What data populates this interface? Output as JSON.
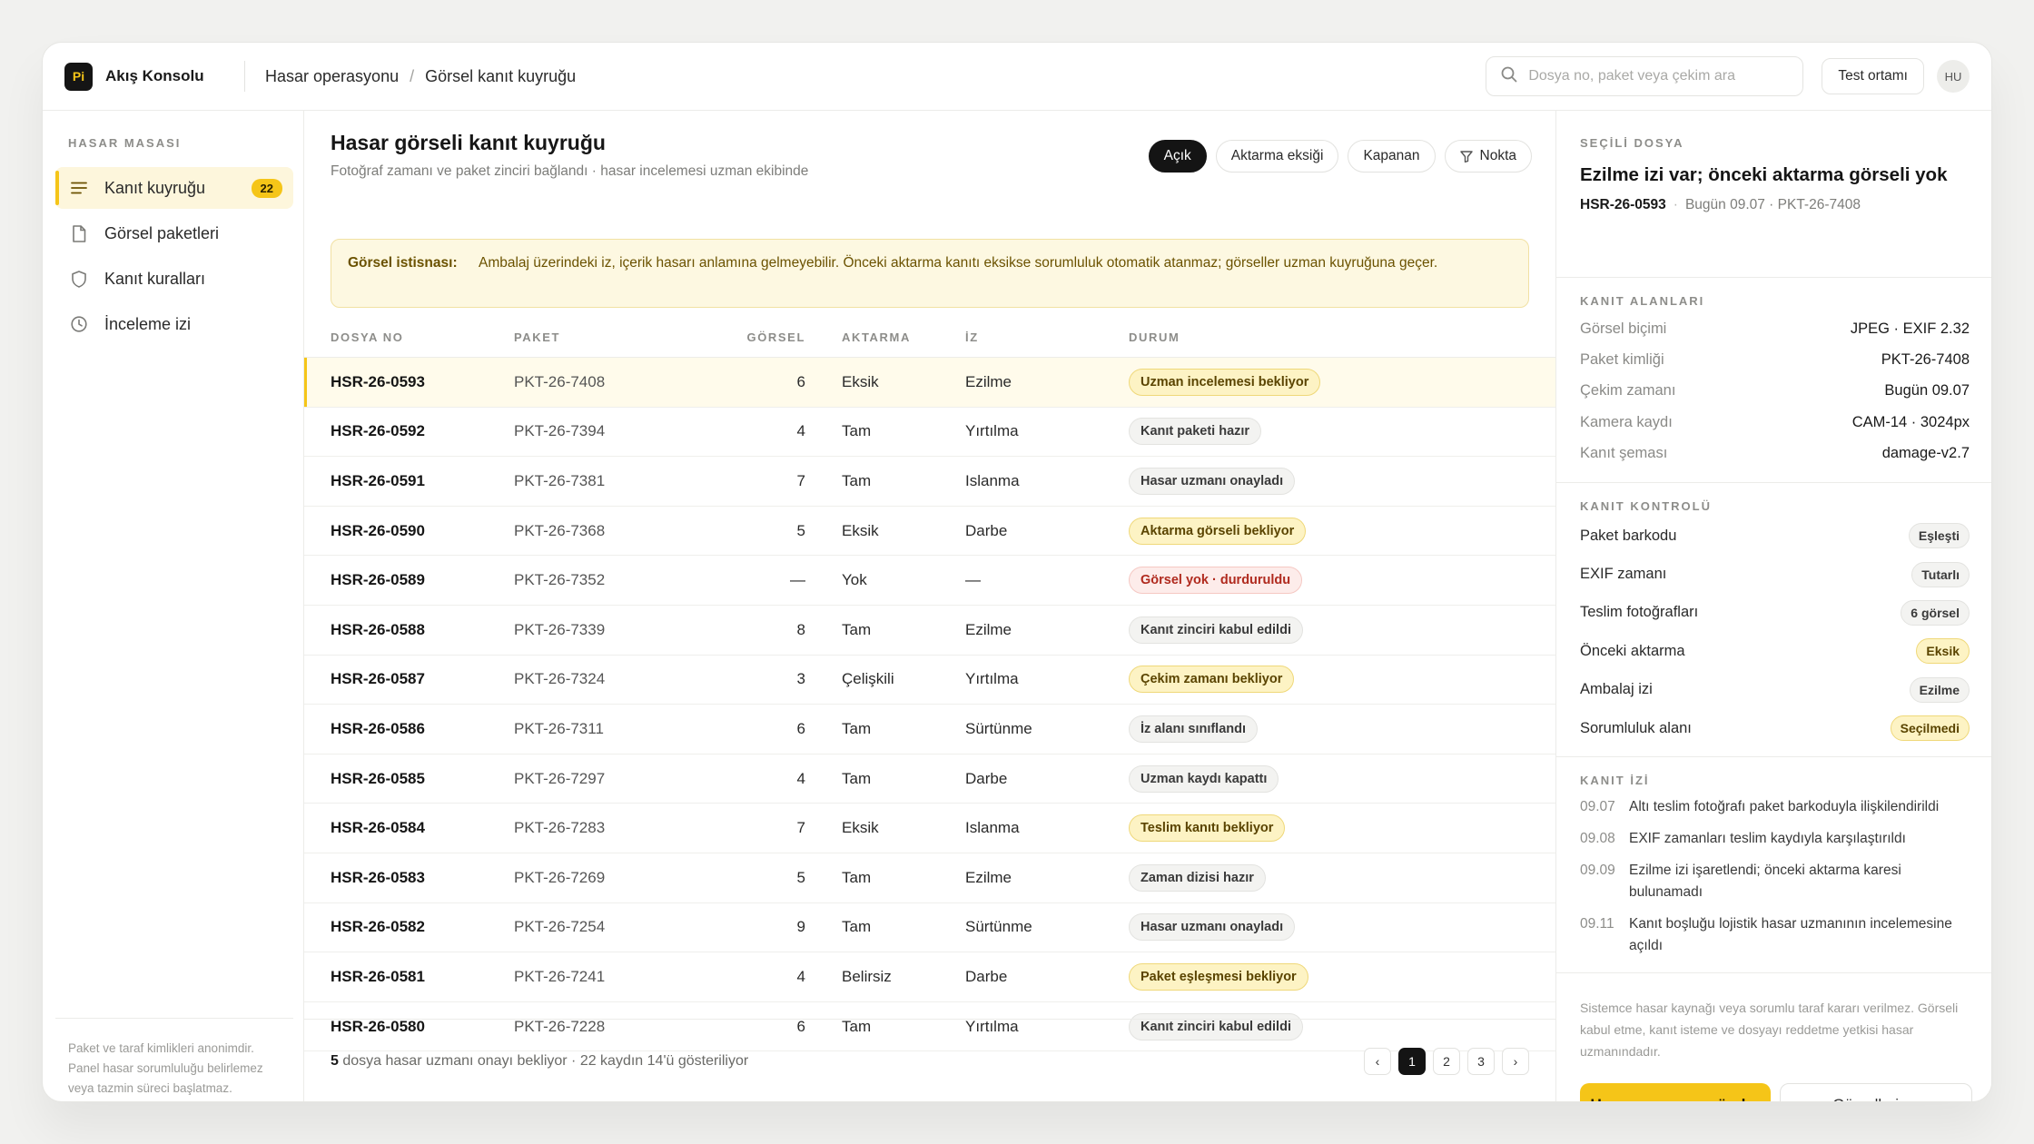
{
  "app": {
    "logo": "Pi",
    "name": "Akış Konsolu",
    "breadcrumb": [
      "Hasar operasyonu",
      "Görsel kanıt kuyruğu"
    ],
    "search_placeholder": "Dosya no, paket veya çekim ara",
    "env_label": "Test ortamı",
    "avatar": "HU"
  },
  "sidebar": {
    "section": "HASAR MASASI",
    "items": [
      {
        "label": "Kanıt kuyruğu",
        "icon": "list-icon",
        "badge": "22",
        "active": true
      },
      {
        "label": "Görsel paketleri",
        "icon": "file-icon",
        "badge": "",
        "active": false
      },
      {
        "label": "Kanıt kuralları",
        "icon": "shield-icon",
        "badge": "",
        "active": false
      },
      {
        "label": "İnceleme izi",
        "icon": "clock-icon",
        "badge": "",
        "active": false
      }
    ],
    "footer": "Paket ve taraf kimlikleri anonimdir. Panel hasar sorumluluğu belirlemez veya tazmin süreci başlatmaz."
  },
  "main": {
    "title": "Hasar görseli kanıt kuyruğu",
    "subtitle": "Fotoğraf zamanı ve paket zinciri bağlandı · hasar incelemesi uzman ekibinde",
    "filters": [
      "Açık",
      "Aktarma eksiği",
      "Kapanan",
      "Nokta"
    ],
    "notice_label": "Görsel istisnası:",
    "notice_text": "Ambalaj üzerindeki iz, içerik hasarı anlamına gelmeyebilir. Önceki aktarma kanıtı eksikse sorumluluk otomatik atanmaz; görseller uzman kuyruğuna geçer.",
    "columns": [
      "DOSYA NO",
      "PAKET",
      "GÖRSEL",
      "AKTARMA",
      "İZ",
      "DURUM"
    ],
    "rows": [
      {
        "file": "HSR-26-0593",
        "pkt": "PKT-26-7408",
        "img": "6",
        "akt": "Eksik",
        "iz": "Ezilme",
        "status": "Uzman incelemesi bekliyor",
        "tone": "yellow"
      },
      {
        "file": "HSR-26-0592",
        "pkt": "PKT-26-7394",
        "img": "4",
        "akt": "Tam",
        "iz": "Yırtılma",
        "status": "Kanıt paketi hazır",
        "tone": "gray"
      },
      {
        "file": "HSR-26-0591",
        "pkt": "PKT-26-7381",
        "img": "7",
        "akt": "Tam",
        "iz": "Islanma",
        "status": "Hasar uzmanı onayladı",
        "tone": "gray"
      },
      {
        "file": "HSR-26-0590",
        "pkt": "PKT-26-7368",
        "img": "5",
        "akt": "Eksik",
        "iz": "Darbe",
        "status": "Aktarma görseli bekliyor",
        "tone": "yellow"
      },
      {
        "file": "HSR-26-0589",
        "pkt": "PKT-26-7352",
        "img": "—",
        "akt": "Yok",
        "iz": "—",
        "status": "Görsel yok · durduruldu",
        "tone": "red"
      },
      {
        "file": "HSR-26-0588",
        "pkt": "PKT-26-7339",
        "img": "8",
        "akt": "Tam",
        "iz": "Ezilme",
        "status": "Kanıt zinciri kabul edildi",
        "tone": "gray"
      },
      {
        "file": "HSR-26-0587",
        "pkt": "PKT-26-7324",
        "img": "3",
        "akt": "Çelişkili",
        "iz": "Yırtılma",
        "status": "Çekim zamanı bekliyor",
        "tone": "yellow"
      },
      {
        "file": "HSR-26-0586",
        "pkt": "PKT-26-7311",
        "img": "6",
        "akt": "Tam",
        "iz": "Sürtünme",
        "status": "İz alanı sınıflandı",
        "tone": "gray"
      },
      {
        "file": "HSR-26-0585",
        "pkt": "PKT-26-7297",
        "img": "4",
        "akt": "Tam",
        "iz": "Darbe",
        "status": "Uzman kaydı kapattı",
        "tone": "gray"
      },
      {
        "file": "HSR-26-0584",
        "pkt": "PKT-26-7283",
        "img": "7",
        "akt": "Eksik",
        "iz": "Islanma",
        "status": "Teslim kanıtı bekliyor",
        "tone": "yellow"
      },
      {
        "file": "HSR-26-0583",
        "pkt": "PKT-26-7269",
        "img": "5",
        "akt": "Tam",
        "iz": "Ezilme",
        "status": "Zaman dizisi hazır",
        "tone": "gray"
      },
      {
        "file": "HSR-26-0582",
        "pkt": "PKT-26-7254",
        "img": "9",
        "akt": "Tam",
        "iz": "Sürtünme",
        "status": "Hasar uzmanı onayladı",
        "tone": "gray"
      },
      {
        "file": "HSR-26-0581",
        "pkt": "PKT-26-7241",
        "img": "4",
        "akt": "Belirsiz",
        "iz": "Darbe",
        "status": "Paket eşleşmesi bekliyor",
        "tone": "yellow"
      },
      {
        "file": "HSR-26-0580",
        "pkt": "PKT-26-7228",
        "img": "6",
        "akt": "Tam",
        "iz": "Yırtılma",
        "status": "Kanıt zinciri kabul edildi",
        "tone": "gray"
      }
    ],
    "footer_count": "5",
    "footer_text": " dosya hasar uzmanı onayı bekliyor · 22 kaydın 14'ü gösteriliyor",
    "pager": {
      "prev": "‹",
      "pages": [
        "1",
        "2",
        "3"
      ],
      "next": "›"
    }
  },
  "panel": {
    "section": "SEÇİLİ DOSYA",
    "title": "Ezilme izi var; önceki aktarma görseli yok",
    "file": "HSR-26-0593",
    "meta": "Bugün 09.07 · PKT-26-7408",
    "fields_label": "KANIT ALANLARI",
    "fields": [
      {
        "k": "Görsel biçimi",
        "v": "JPEG · EXIF 2.32"
      },
      {
        "k": "Paket kimliği",
        "v": "PKT-26-7408"
      },
      {
        "k": "Çekim zamanı",
        "v": "Bugün 09.07"
      },
      {
        "k": "Kamera kaydı",
        "v": "CAM-14 · 3024px"
      },
      {
        "k": "Kanıt şeması",
        "v": "damage-v2.7"
      }
    ],
    "checks_label": "KANIT KONTROLÜ",
    "checks": [
      {
        "k": "Paket barkodu",
        "v": "Eşleşti",
        "tone": "gray"
      },
      {
        "k": "EXIF zamanı",
        "v": "Tutarlı",
        "tone": "gray"
      },
      {
        "k": "Teslim fotoğrafları",
        "v": "6 görsel",
        "tone": "gray"
      },
      {
        "k": "Önceki aktarma",
        "v": "Eksik",
        "tone": "yellow"
      },
      {
        "k": "Ambalaj izi",
        "v": "Ezilme",
        "tone": "gray"
      },
      {
        "k": "Sorumluluk alanı",
        "v": "Seçilmedi",
        "tone": "yellow"
      }
    ],
    "trail_label": "KANIT İZİ",
    "trail": [
      {
        "t": "09.07",
        "d": "Altı teslim fotoğrafı paket barkoduyla ilişkilendirildi"
      },
      {
        "t": "09.08",
        "d": "EXIF zamanları teslim kaydıyla karşılaştırıldı"
      },
      {
        "t": "09.09",
        "d": "Ezilme izi işaretlendi; önceki aktarma karesi bulunamadı"
      },
      {
        "t": "09.11",
        "d": "Kanıt boşluğu lojistik hasar uzmanının incelemesine açıldı"
      }
    ],
    "note": "Sistemce hasar kaynağı veya sorumlu taraf kararı verilmez. Görseli kabul etme, kanıt isteme ve dosyayı reddetme yetkisi hasar uzmanındadır.",
    "primary_button": "Uzman onayına gönder",
    "secondary_button": "Görselleri aç"
  }
}
